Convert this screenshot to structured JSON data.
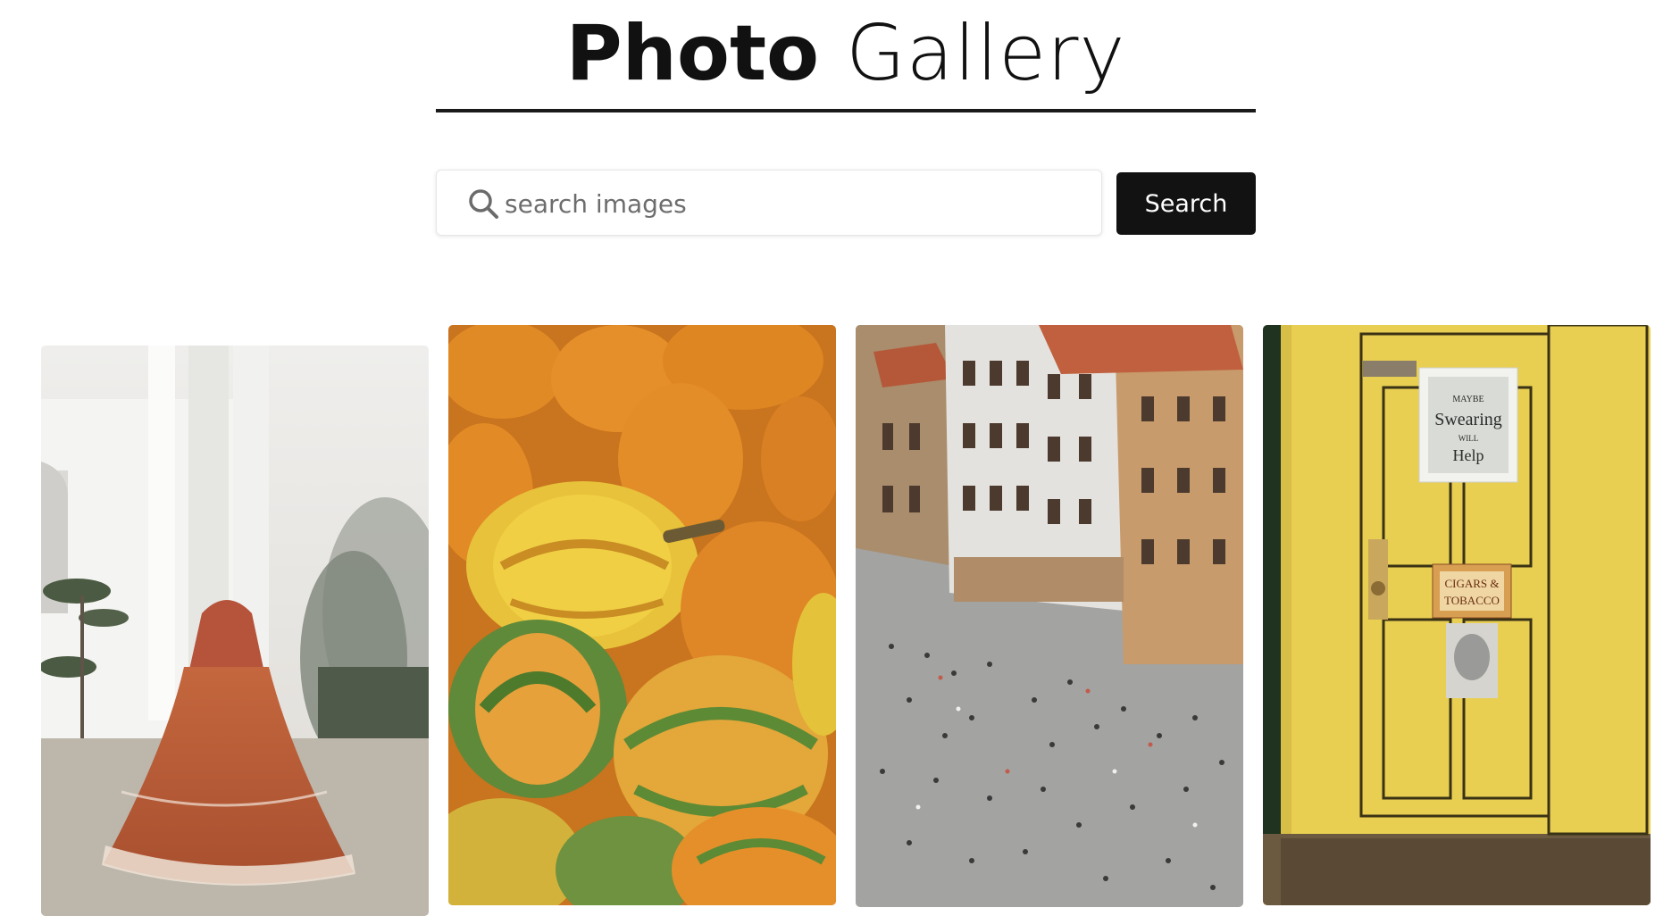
{
  "header": {
    "title_bold": "Photo",
    "title_light": "Gallery"
  },
  "search": {
    "placeholder": "search images",
    "value": "",
    "button_label": "Search"
  },
  "icons": {
    "search": "search-icon"
  },
  "colors": {
    "button_bg": "#121212",
    "divider": "#1a1a1a"
  },
  "gallery": {
    "images": [
      {
        "subject": "bride-in-orange-lehenga"
      },
      {
        "subject": "orange-and-yellow-squash"
      },
      {
        "subject": "city-square-from-above"
      },
      {
        "subject": "yellow-door",
        "poster_text": "MAYBE Swearing WILL Help",
        "sign_text": "CIGARS & TOBACCO"
      }
    ]
  }
}
